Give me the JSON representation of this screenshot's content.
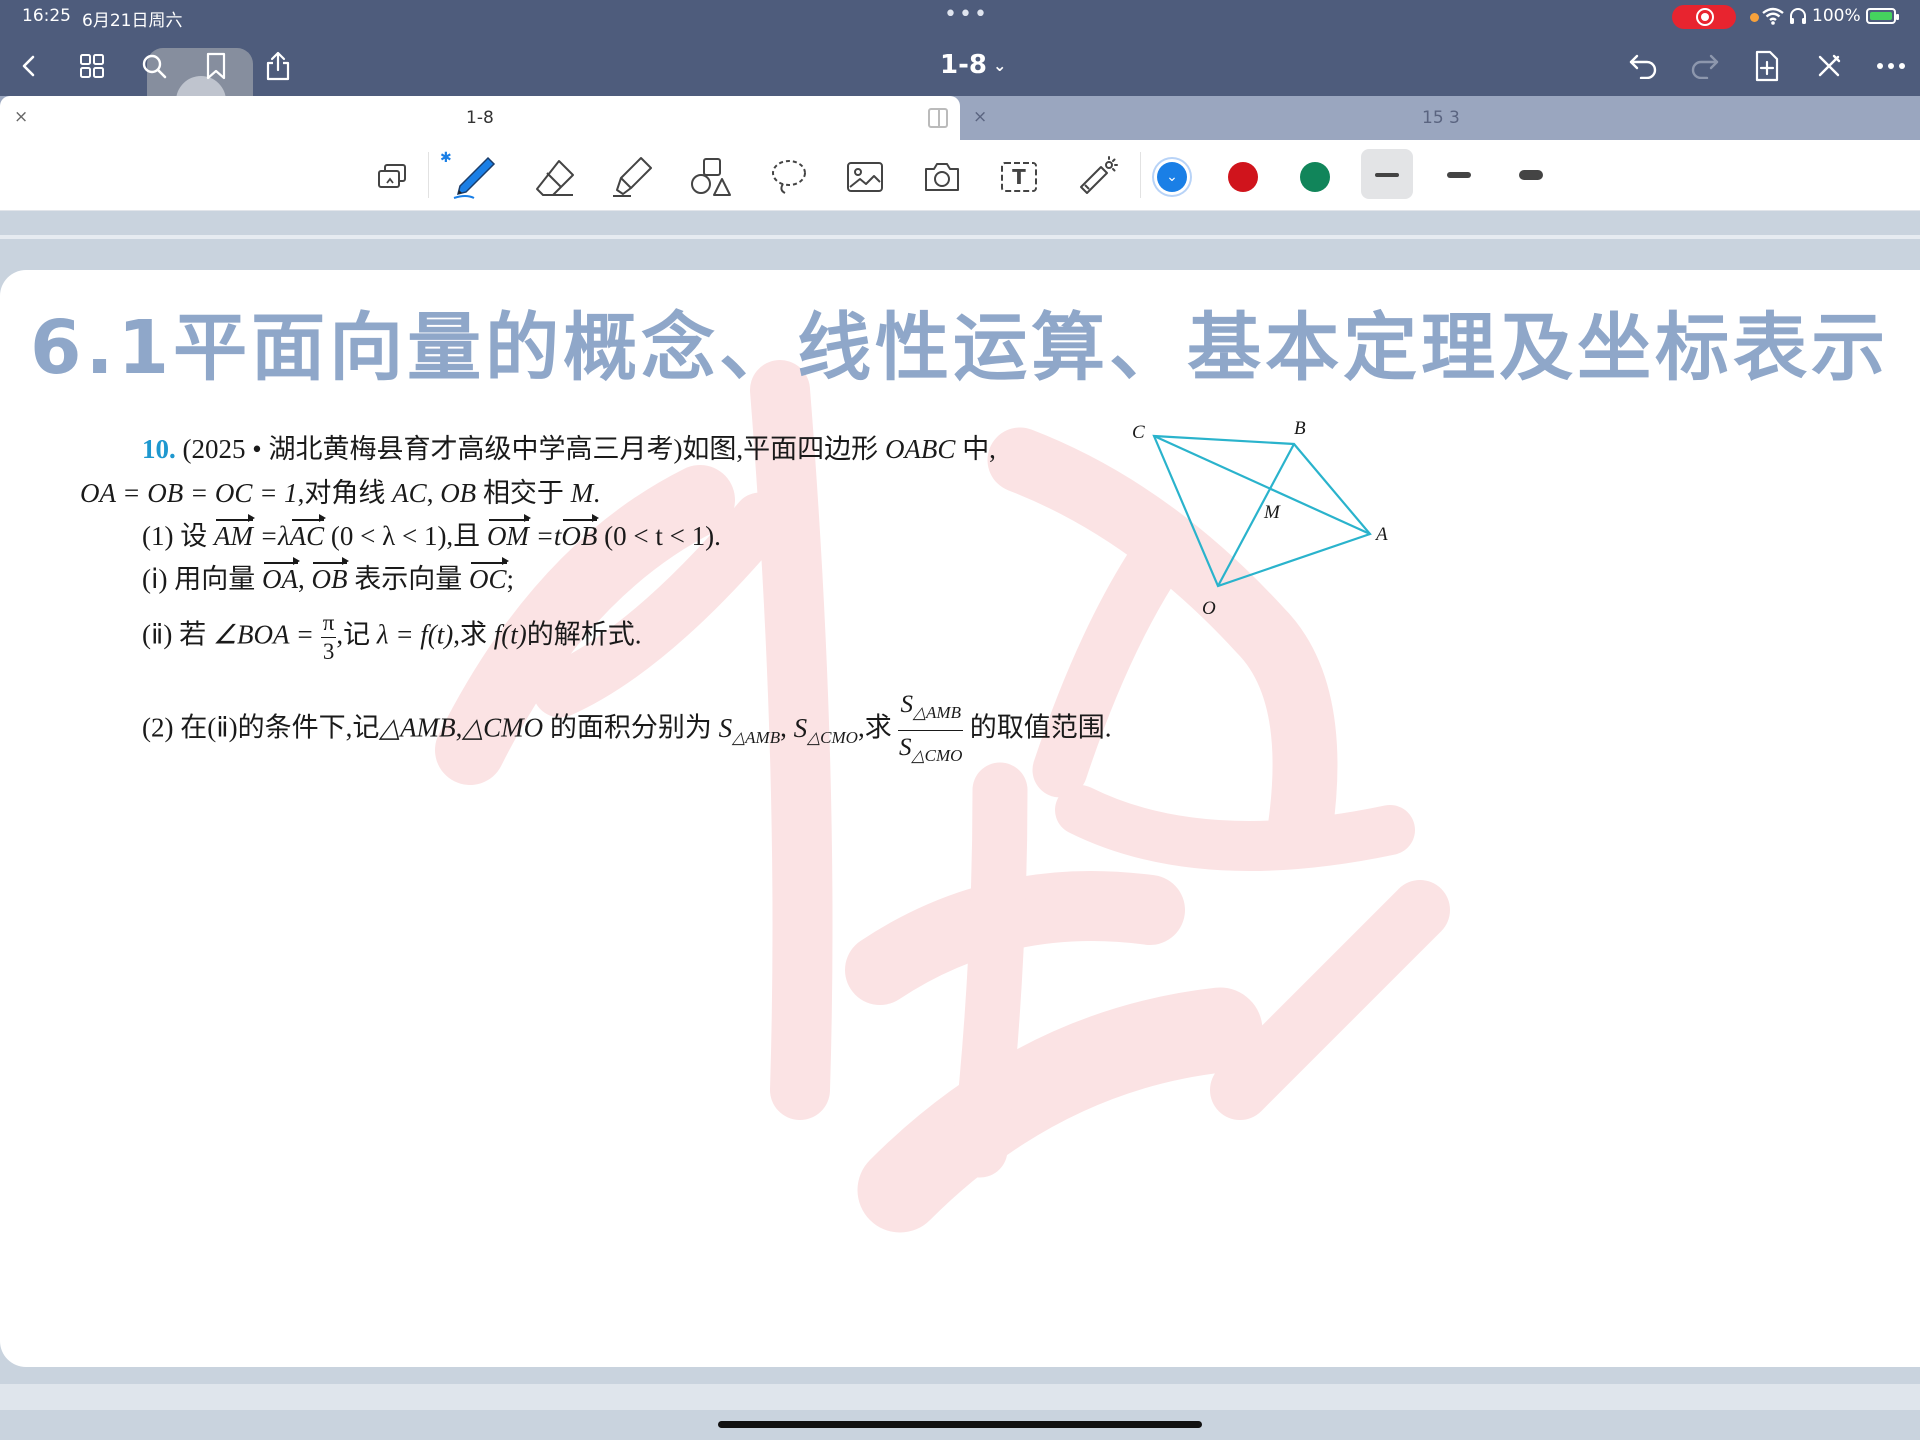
{
  "status_bar": {
    "time": "16:25",
    "date": "6月21日周六",
    "battery": "100%",
    "battery_level_pct": 100,
    "record_color": "#e8242f",
    "battery_color": "#45d35e"
  },
  "nav": {
    "doc_title": "1-8",
    "title_chevron": "⌄",
    "bar_color": "#4e5c7c",
    "icons": [
      "back-icon",
      "grid-icon",
      "search-icon",
      "bookmark-icon",
      "share-icon",
      "undo-icon",
      "redo-icon",
      "add-page-icon",
      "close-icon",
      "more-icon"
    ]
  },
  "tabs": [
    {
      "label": "1-8",
      "close": "×"
    },
    {
      "label": "15 3",
      "close": "×"
    }
  ],
  "toolbar": {
    "tools": [
      "lasso-select-icon",
      "pen-icon",
      "eraser-icon",
      "highlighter-icon",
      "shapes-icon",
      "lasso-icon",
      "image-icon",
      "camera-icon",
      "text-box-icon",
      "laser-pointer-icon"
    ],
    "bluetooth_glyph": "✱",
    "text_tool_glyph": "T",
    "colors": [
      "#1a7fe6",
      "#d0141c",
      "#11855a"
    ],
    "selected_color": "#1a7fe6",
    "selected_check": "⌄",
    "stroke_widths": [
      "thin",
      "medium",
      "thick"
    ],
    "selected_stroke": "thin"
  },
  "page": {
    "heading": "6.1平面向量的概念、线性运算、基本定理及坐标表示",
    "question_number": "10.",
    "source": "(2025 • 湖北黄梅县育才高级中学高三月考)如图,平面四边形",
    "quad": "OABC",
    "source_tail": "中,",
    "line2": {
      "eq": "OA = OB = OC = 1",
      "tail": ",对角线",
      "ac": "AC",
      "sep": ",",
      "ob": "OB",
      "meet": "相交于",
      "m": "M",
      "end": "."
    },
    "part1": {
      "lead": "(1) 设",
      "am": "AM",
      "eq1": "=λ",
      "ac": "AC",
      "cond1": "(0 < λ < 1),且",
      "om": "OM",
      "eq2": "=t",
      "ob": "OB",
      "cond2": "(0 < t < 1)."
    },
    "part1_i": {
      "lead": "(ⅰ) 用向量",
      "oa": "OA",
      "sep": ",",
      "ob": "OB",
      "mid": "表示向量",
      "oc": "OC",
      "end": ";"
    },
    "part1_ii": {
      "lead": "(ⅱ) 若",
      "angle": "∠BOA =",
      "frac_num": "π",
      "frac_den": "3",
      "mid": ",记",
      "lam": "λ = f(t)",
      "mid2": ",求",
      "ft": "f(t)",
      "end": "的解析式."
    },
    "part2": {
      "lead": "(2) 在(ⅱ)的条件下,记",
      "tri1": "△AMB",
      "sep": ",",
      "tri2": "△CMO",
      "mid": "的面积分别为",
      "s": "S",
      "sub1": "△AMB",
      "sep2": ",",
      "sub2": "△CMO",
      "mid2": ",求",
      "end": "的取值范围."
    },
    "diagram_labels": {
      "c": "C",
      "b": "B",
      "m": "M",
      "a": "A",
      "o": "O"
    },
    "diagram_color": "#2ab3cc",
    "heading_color": "#8fa7c9",
    "number_color": "#1e98cf"
  }
}
